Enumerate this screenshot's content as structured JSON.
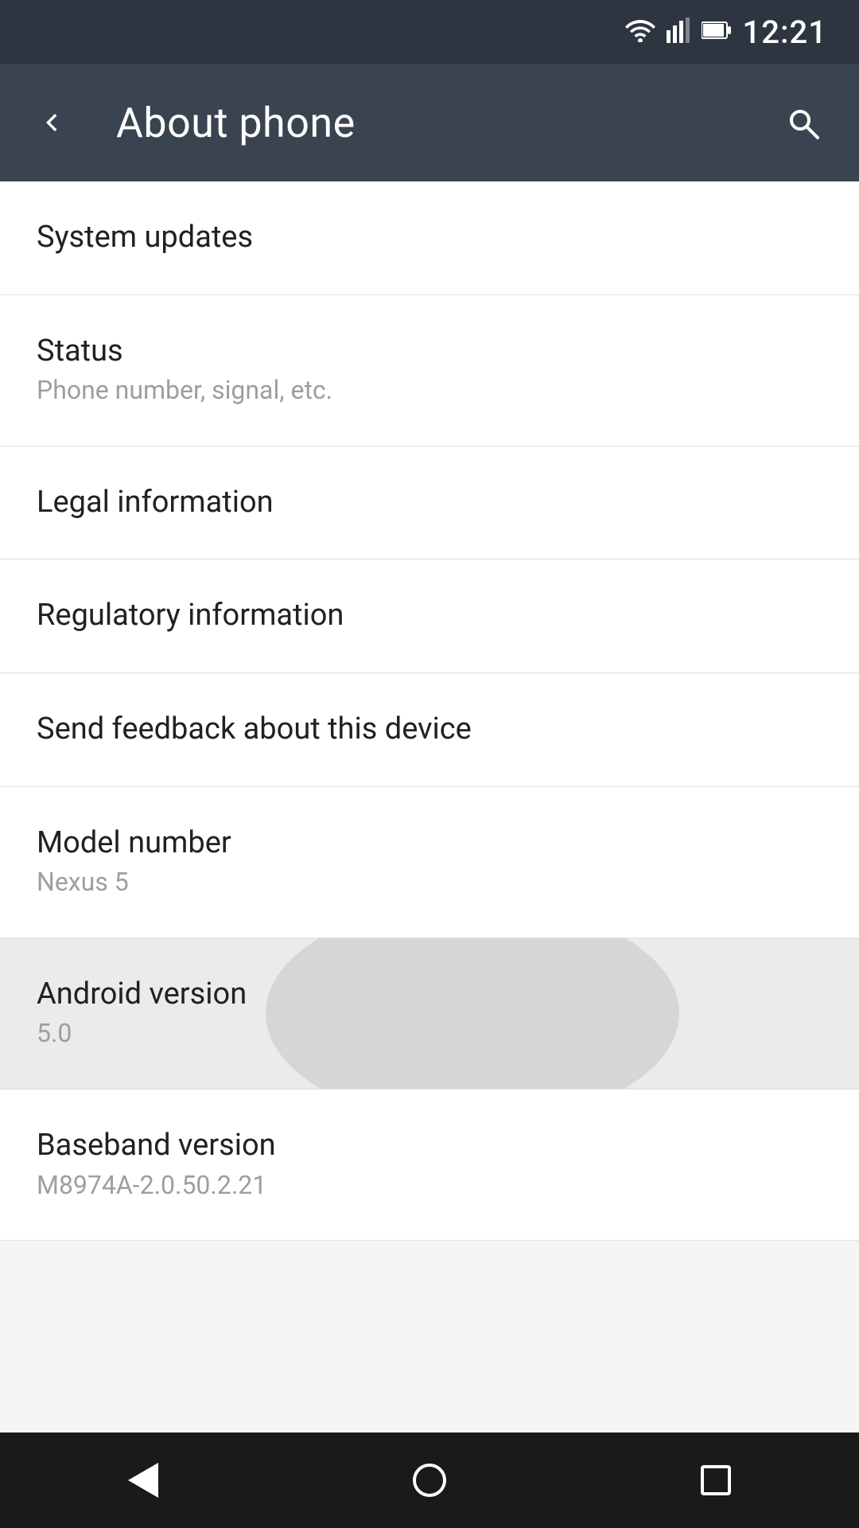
{
  "statusBar": {
    "time": "12:21",
    "wifiIcon": "wifi",
    "signalIcon": "signal",
    "batteryIcon": "battery"
  },
  "toolbar": {
    "title": "About phone",
    "backLabel": "←",
    "searchLabel": "🔍"
  },
  "menuItems": [
    {
      "id": "system-updates",
      "title": "System updates",
      "subtitle": null
    },
    {
      "id": "status",
      "title": "Status",
      "subtitle": "Phone number, signal, etc."
    },
    {
      "id": "legal-information",
      "title": "Legal information",
      "subtitle": null
    },
    {
      "id": "regulatory-information",
      "title": "Regulatory information",
      "subtitle": null
    },
    {
      "id": "send-feedback",
      "title": "Send feedback about this device",
      "subtitle": null
    },
    {
      "id": "model-number",
      "title": "Model number",
      "subtitle": "Nexus 5"
    },
    {
      "id": "android-version",
      "title": "Android version",
      "subtitle": "5.0",
      "active": true
    },
    {
      "id": "baseband-version",
      "title": "Baseband version",
      "subtitle": "M8974A-2.0.50.2.21"
    }
  ],
  "navBar": {
    "backLabel": "back",
    "homeLabel": "home",
    "recentLabel": "recent"
  }
}
